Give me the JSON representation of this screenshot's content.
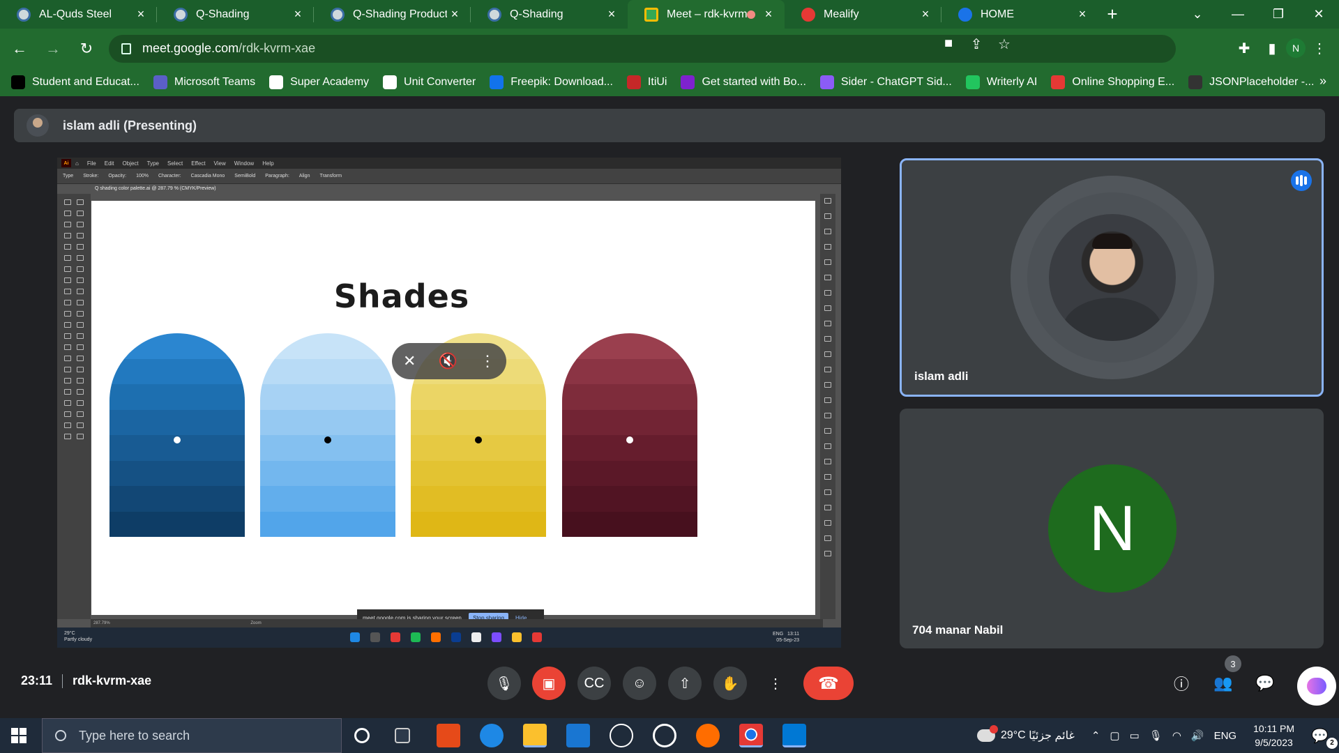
{
  "browser": {
    "tabs": [
      {
        "title": "AL-Quds Steel",
        "favicon": "globe-icon"
      },
      {
        "title": "Q-Shading",
        "favicon": "globe-icon"
      },
      {
        "title": "Q-Shading Products",
        "favicon": "globe-icon"
      },
      {
        "title": "Q-Shading",
        "favicon": "globe-icon"
      },
      {
        "title": "Meet – rdk-kvrm-",
        "favicon": "meet-icon",
        "active": true
      },
      {
        "title": "Mealify",
        "favicon": "mealify-icon"
      },
      {
        "title": "HOME",
        "favicon": "home-icon"
      }
    ],
    "url_host": "meet.google.com",
    "url_path": "/rdk-kvrm-xae",
    "profile_initial": "N",
    "bookmarks": [
      {
        "label": "Student and Educat...",
        "color": "#000000"
      },
      {
        "label": "Microsoft Teams",
        "color": "#5b5fc7"
      },
      {
        "label": "Super Academy",
        "color": "#ffffff"
      },
      {
        "label": "Unit Converter",
        "color": "#ffffff"
      },
      {
        "label": "Freepik: Download...",
        "color": "#1273eb"
      },
      {
        "label": "ItiUi",
        "color": "#c62828"
      },
      {
        "label": "Get started with Bo...",
        "color": "#7e22ce"
      },
      {
        "label": "Sider - ChatGPT Sid...",
        "color": "#8b5cf6"
      },
      {
        "label": "Writerly AI",
        "color": "#22c55e"
      },
      {
        "label": "Online Shopping E...",
        "color": "#e53935"
      },
      {
        "label": "JSONPlaceholder -...",
        "color": "#333333"
      }
    ]
  },
  "meet": {
    "presenter_label": "islam adli (Presenting)",
    "shared_screen": {
      "menu": [
        "File",
        "Edit",
        "Object",
        "Type",
        "Select",
        "Effect",
        "View",
        "Window",
        "Help"
      ],
      "control_bar": [
        "Type",
        "Stroke:",
        "Opacity:",
        "100%",
        "Character:",
        "Cascadia Mono",
        "SemiBold",
        "Paragraph:",
        "Align",
        "Transform"
      ],
      "doc_tab": "Q shading color palette.ai @ 287.79 % (CMYK/Preview)",
      "artboard_title": "Shades",
      "swatches": [
        {
          "name": "blue",
          "dot": "#ffffff",
          "colors": [
            "#2b86d0",
            "#2279bf",
            "#1d6fb0",
            "#1b65a2",
            "#185b93",
            "#155184",
            "#124775",
            "#0e3d66"
          ]
        },
        {
          "name": "light-blue",
          "dot": "#000000",
          "colors": [
            "#c7e3f8",
            "#b8dbf6",
            "#a7d2f4",
            "#96c9f2",
            "#84c0f0",
            "#73b7ee",
            "#62aeec",
            "#52a5ea"
          ]
        },
        {
          "name": "yellow",
          "dot": "#000000",
          "colors": [
            "#efe08a",
            "#eddb78",
            "#ebd565",
            "#e8cf53",
            "#e6c942",
            "#e3c332",
            "#e1bd24",
            "#dfb716"
          ]
        },
        {
          "name": "maroon",
          "dot": "#ffffff",
          "colors": [
            "#9a3f4e",
            "#8b3444",
            "#7e2c3b",
            "#722434",
            "#661d2d",
            "#5b1828",
            "#511423",
            "#47101e"
          ]
        }
      ],
      "share_banner_text": "meet.google.com is sharing your screen.",
      "stop_sharing_label": "Stop sharing",
      "hide_label": "Hide",
      "status_zoom": "287.79%",
      "status_tool": "Zoom",
      "mini_weather": "29°C",
      "mini_weather_desc": "Partly cloudy",
      "mini_time": "13:11",
      "mini_date": "05-Sep-23",
      "mini_lang": "ENG"
    },
    "participants": [
      {
        "name": "islam adli",
        "speaking": true
      },
      {
        "name": "704 manar Nabil",
        "initial": "N",
        "avatar_color": "#1e6b1e"
      }
    ],
    "bottom": {
      "time": "23:11",
      "meeting_code": "rdk-kvrm-xae",
      "people_count": "3"
    }
  },
  "taskbar": {
    "search_placeholder": "Type here to search",
    "weather_temp": "29°C",
    "weather_desc": "غائم جزئيًا",
    "lang": "ENG",
    "time": "10:11 PM",
    "date": "9/5/2023",
    "notification_count": "2"
  }
}
